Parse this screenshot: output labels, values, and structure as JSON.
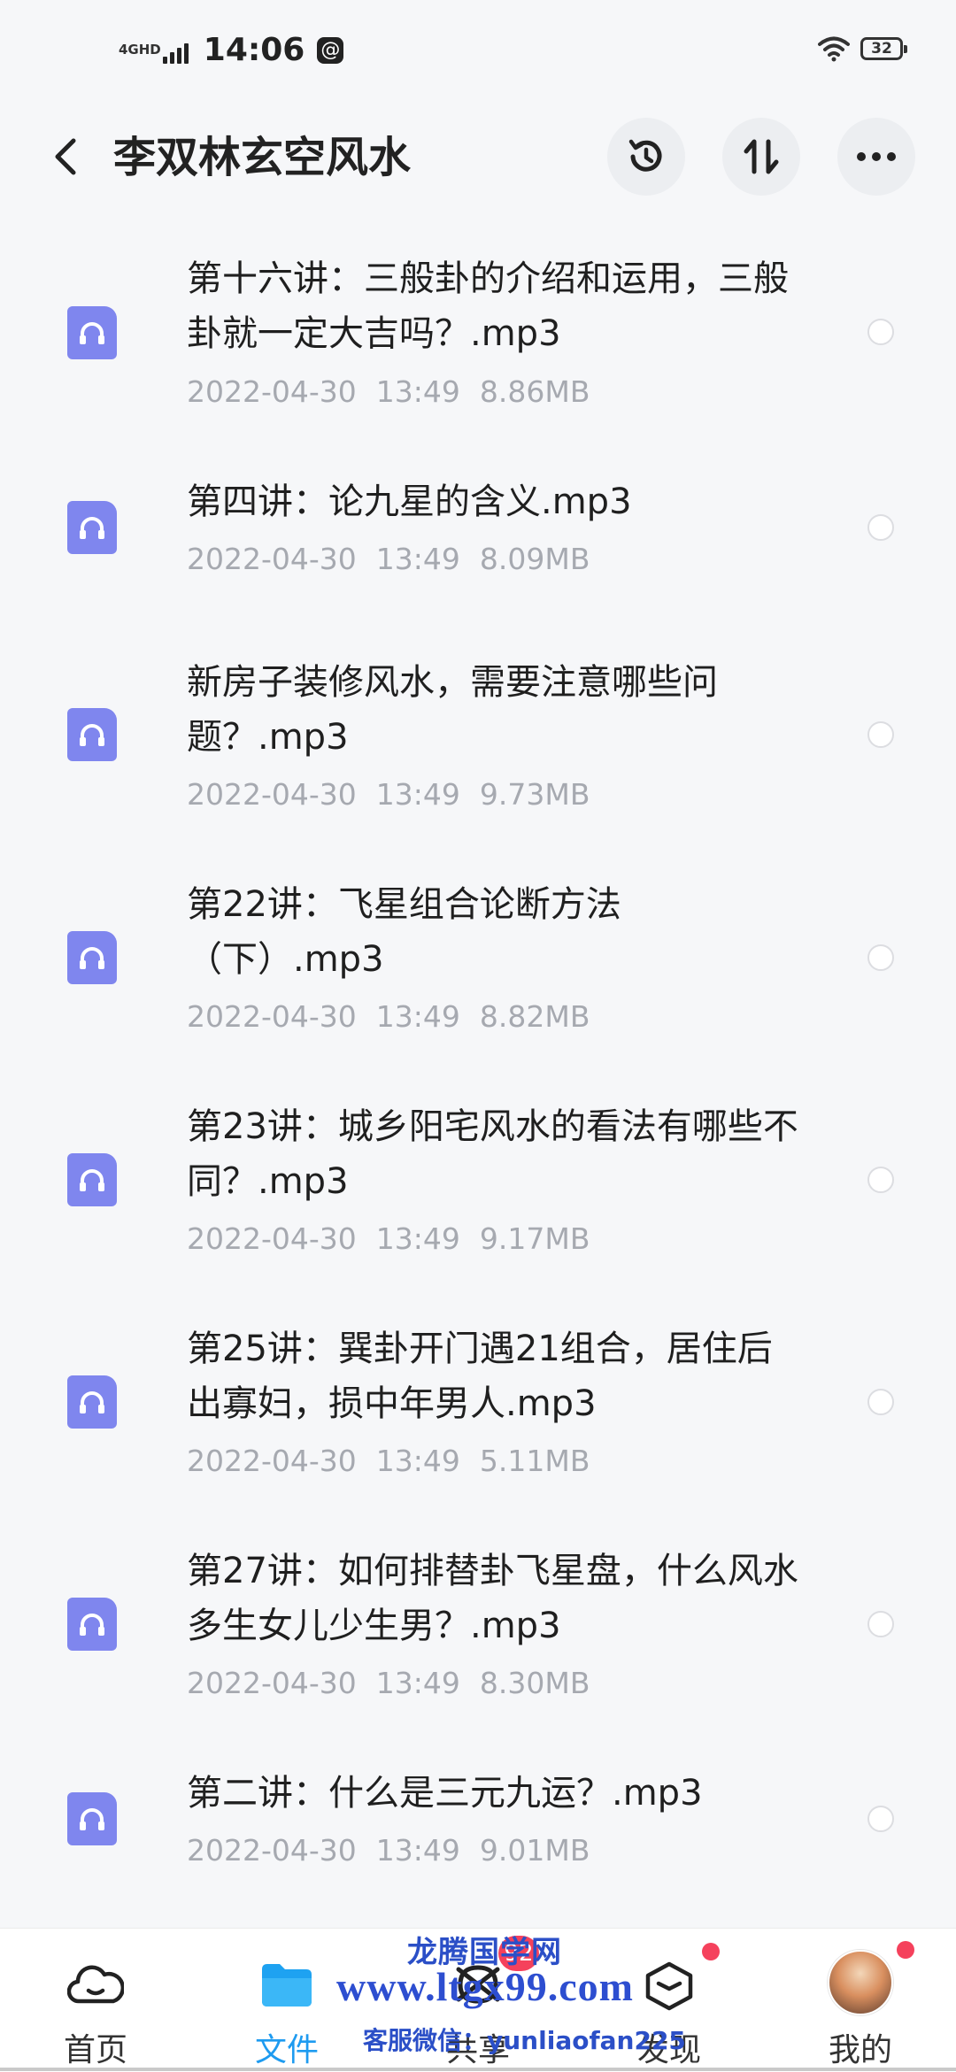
{
  "status_bar": {
    "network": "4GHD",
    "time": "14:06",
    "app_icon": "@",
    "battery": "32",
    "icons": [
      "signal-icon",
      "wifi-icon",
      "battery-icon"
    ]
  },
  "header": {
    "title": "李双林玄空风水",
    "icons": [
      "back-arrow-icon",
      "history-clock-icon",
      "sort-icon",
      "more-dots-icon"
    ]
  },
  "files": [
    {
      "name": "第十六讲：三般卦的介绍和运用，三般卦就一定大吉吗？.mp3",
      "date": "2022-04-30",
      "time": "13:49",
      "size": "8.86MB"
    },
    {
      "name": "第四讲：论九星的含义.mp3",
      "date": "2022-04-30",
      "time": "13:49",
      "size": "8.09MB"
    },
    {
      "name": "新房子装修风水，需要注意哪些问题？.mp3",
      "date": "2022-04-30",
      "time": "13:49",
      "size": "9.73MB"
    },
    {
      "name": "第22讲：飞星组合论断方法（下）.mp3",
      "date": "2022-04-30",
      "time": "13:49",
      "size": "8.82MB"
    },
    {
      "name": "第23讲：城乡阳宅风水的看法有哪些不同？.mp3",
      "date": "2022-04-30",
      "time": "13:49",
      "size": "9.17MB"
    },
    {
      "name": "第25讲：巽卦开门遇21组合，居住后出寡妇，损中年男人.mp3",
      "date": "2022-04-30",
      "time": "13:49",
      "size": "5.11MB"
    },
    {
      "name": "第27讲：如何排替卦飞星盘，什么风水多生女儿少生男？.mp3",
      "date": "2022-04-30",
      "time": "13:49",
      "size": "8.30MB"
    },
    {
      "name": "第二讲：什么是三元九运？.mp3",
      "date": "2022-04-30",
      "time": "13:49",
      "size": "9.01MB"
    }
  ],
  "bottom_nav": {
    "items": [
      {
        "label": "首页",
        "icon": "cloud-home-icon"
      },
      {
        "label": "文件",
        "icon": "folder-icon",
        "active": true
      },
      {
        "label": "共享",
        "icon": "share-icon",
        "badge": "92"
      },
      {
        "label": "发现",
        "icon": "discover-cube-icon"
      },
      {
        "label": "我的",
        "icon": "avatar"
      }
    ]
  },
  "watermark": {
    "line1": "龙腾国学网",
    "line2": "www.ltgx99.com",
    "line3": "客服微信：yunliaofan225"
  },
  "colors": {
    "accent": "#1e9bf0",
    "file_icon": "#7f86ee",
    "meta_text": "#a6a9b0",
    "badge": "#f5415c",
    "watermark": "#2b4fc7"
  }
}
